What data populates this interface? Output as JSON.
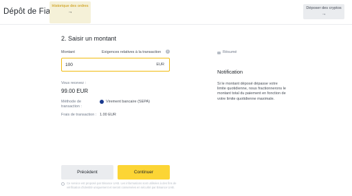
{
  "header": {
    "title": "Dépôt de Fiat",
    "history_button": {
      "label": "Historique des ordres",
      "arrow": "→"
    },
    "crypto_button": {
      "label": "Déposer des cryptos",
      "arrow": "→"
    }
  },
  "form": {
    "step_title": "2. Saisir un montant",
    "amount_label": "Montant",
    "requirements_label": "Exigences relatives à la transaction",
    "amount_value": "100",
    "currency": "EUR",
    "receive_label": "Vous recevez :",
    "receive_value": "99.00 EUR",
    "method_label": "Méthode de transaction :",
    "method_value": "Virement bancaire (SEPA)",
    "fees_label": "Frais de transaction :",
    "fees_value": "1.00 EUR"
  },
  "side": {
    "summary_label": "Résumé",
    "notification_title": "Notification",
    "notification_text": "Si le montant déposé dépasse votre limite quotidienne, nous fractionnerons le montant total du paiement en fonction de votre limite quotidienne maximale."
  },
  "actions": {
    "previous_label": "Précédent",
    "continue_label": "Continuer"
  },
  "footer": {
    "disclaimer": "Ce service est proposé par Binance UAB. Les informations sont utilisées à des fins de vérification d'identité uniquement et seront conservées en sécurité par Binance UAB."
  },
  "colors": {
    "accent": "#fcd535",
    "accent_border": "#f0b90b",
    "history_bg": "#f5f1d8"
  },
  "icons": {
    "history_arrow": "arrow-right-icon",
    "crypto_arrow": "arrow-right-icon",
    "info": "info-icon",
    "sepa": "sepa-bank-icon",
    "summary": "summary-icon",
    "disclaimer": "shield-icon"
  }
}
